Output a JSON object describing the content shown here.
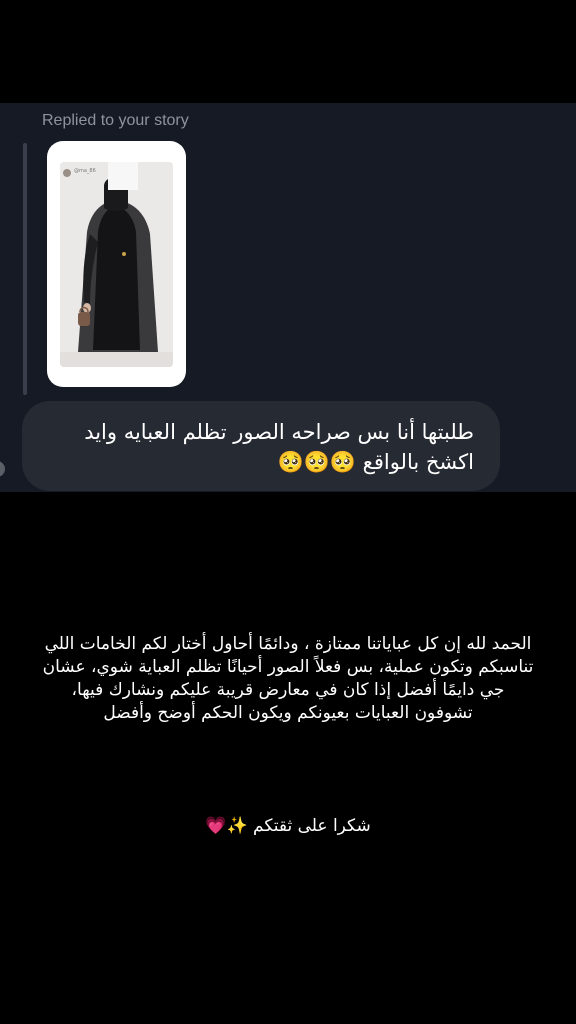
{
  "reply": {
    "label": "Replied to your story",
    "story_username": "@ma_86"
  },
  "message": {
    "text": "طلبتها أنا بس صراحه الصور تظلم العبايه وايد اكشخ بالواقع 🥺🥺🥺"
  },
  "story_caption": {
    "body": "الحمد لله إن كل عباياتنا ممتازة ، ودائمًا أحاول أختار لكم الخامات اللي تناسبكم وتكون عملية، بس فعلاً الصور أحيانًا تظلم العباية شوي، عشان جي دايمًا أفضل إذا كان في معارض قريبة عليكم ونشارك فيها، تشوفون العبايات بعيونكم ويكون الحكم أوضح وأفضل",
    "thanks": "شكرا على ثقتكم ✨💗"
  },
  "colors": {
    "page_bg": "#000000",
    "panel_bg": "#161a24",
    "bubble_bg": "#262a33",
    "muted_text": "#8e939c",
    "abaya": "#1c1c1e"
  }
}
